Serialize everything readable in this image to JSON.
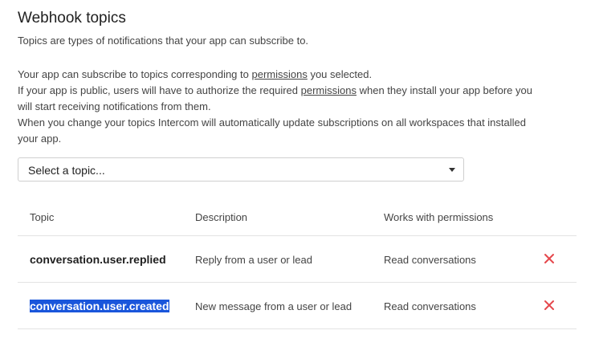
{
  "header": {
    "title": "Webhook topics",
    "subtitle": "Topics are types of notifications that your app can subscribe to."
  },
  "info": {
    "line1_pre": "Your app can subscribe to topics corresponding to ",
    "line1_link": "permissions",
    "line1_post": " you selected.",
    "line2_pre": "If your app is public, users will have to authorize the required ",
    "line2_link": "permissions",
    "line2_post": " when they install your app before you",
    "line3": "will start receiving notifications from them.",
    "line4": "When you change your topics Intercom will automatically update subscriptions on all workspaces that installed",
    "line5": "your app."
  },
  "topic_select": {
    "value": "Select a topic..."
  },
  "table": {
    "columns": [
      "Topic",
      "Description",
      "Works with permissions"
    ],
    "rows": [
      {
        "topic": "conversation.user.replied",
        "description": "Reply from a user or lead",
        "permissions": "Read conversations",
        "selected": false
      },
      {
        "topic": "conversation.user.created",
        "description": "New message from a user or lead",
        "permissions": "Read conversations",
        "selected": true
      }
    ]
  },
  "colors": {
    "remove_icon": "#e5484d",
    "selection_highlight": "#1a56db",
    "divider": "#e3e3e3"
  },
  "icons": {
    "remove": "close-icon",
    "dropdown": "chevron-down-icon"
  }
}
